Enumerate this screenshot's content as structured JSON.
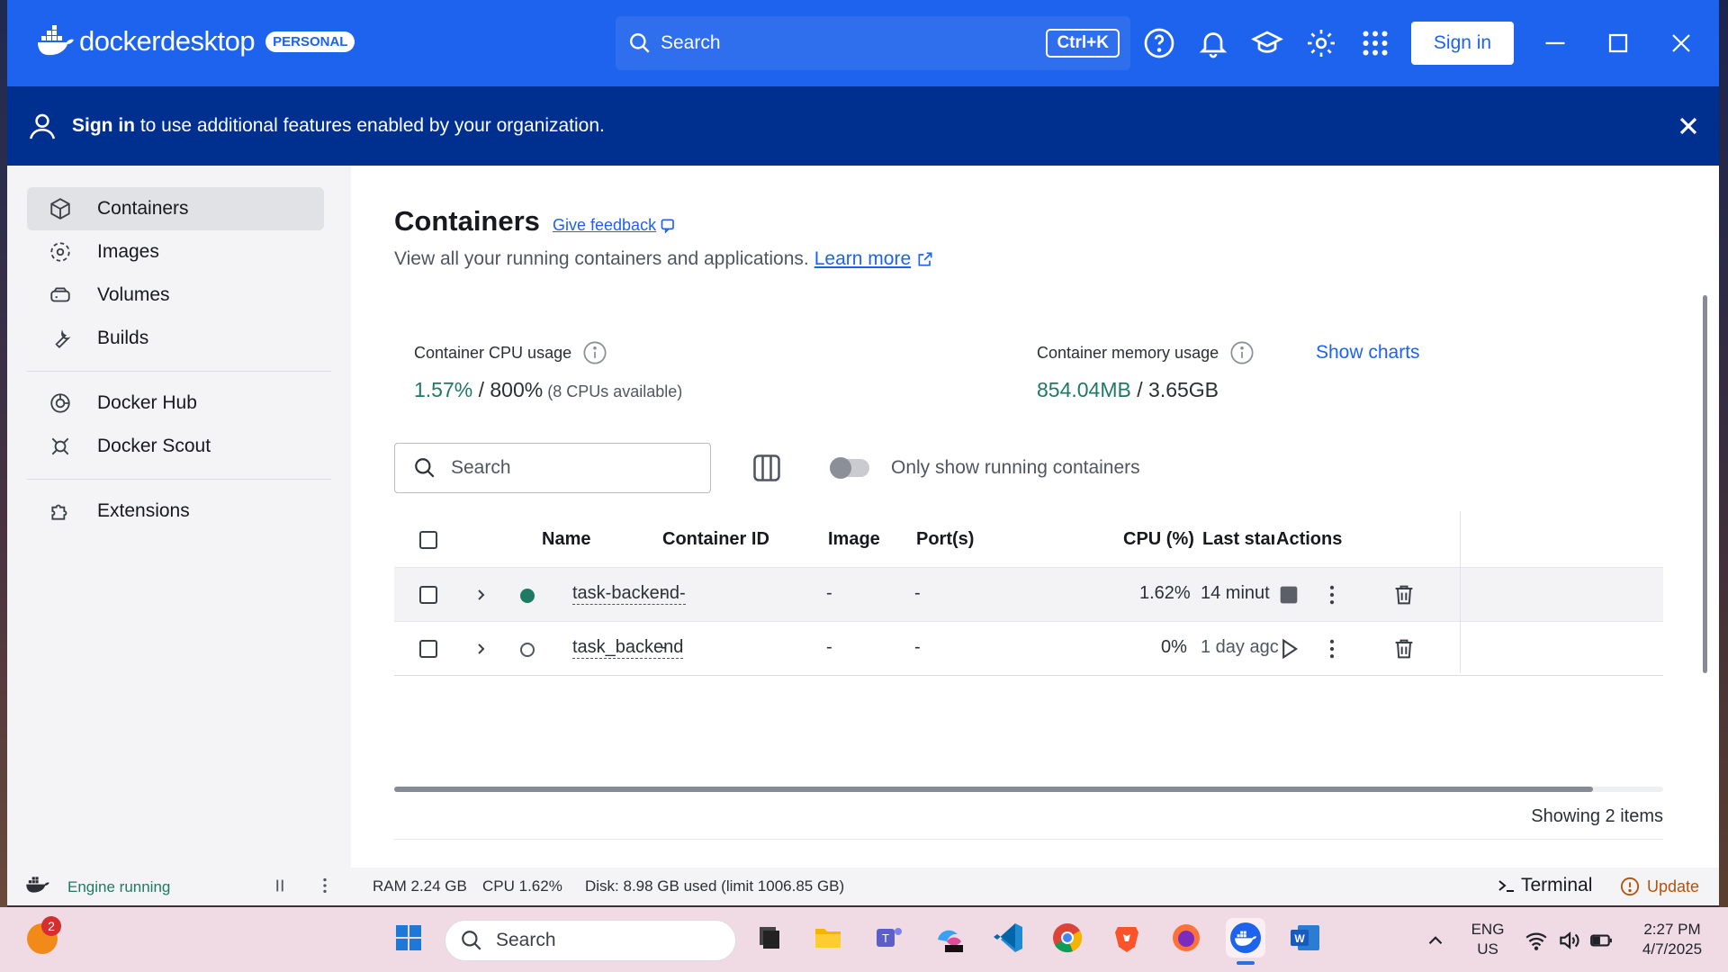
{
  "app": {
    "logo_bold": "docker",
    "logo_light": "desktop",
    "plan_badge": "PERSONAL",
    "search_label": "Search",
    "search_shortcut": "Ctrl+K",
    "sign_in_label": "Sign in",
    "brand_color": "#1d63ed"
  },
  "banner": {
    "bold": "Sign in",
    "text": " to use additional features enabled by your organization."
  },
  "sidebar": {
    "items": [
      {
        "label": "Containers",
        "icon": "cube-icon",
        "active": true
      },
      {
        "label": "Images",
        "icon": "images-icon"
      },
      {
        "label": "Volumes",
        "icon": "volumes-icon"
      },
      {
        "label": "Builds",
        "icon": "wrench-icon"
      },
      {
        "label": "Docker Hub",
        "icon": "hub-icon"
      },
      {
        "label": "Docker Scout",
        "icon": "scout-icon"
      },
      {
        "label": "Extensions",
        "icon": "puzzle-icon"
      }
    ]
  },
  "main": {
    "title": "Containers",
    "feedback_link": "Give feedback",
    "subtitle": "View all your running containers and applications.",
    "learn_more": "Learn more",
    "cpu": {
      "label": "Container CPU usage",
      "used": "1.57%",
      "sep": " / ",
      "total": "800%",
      "note": " (8 CPUs available)"
    },
    "memory": {
      "label": "Container memory usage",
      "used": "854.04MB",
      "sep": " / ",
      "total": "3.65GB"
    },
    "show_charts": "Show charts",
    "search_placeholder": "Search",
    "toggle_label": "Only show running containers",
    "table": {
      "headers": {
        "name": "Name",
        "container_id": "Container ID",
        "image": "Image",
        "ports": "Port(s)",
        "cpu": "CPU (%)",
        "last_started": "Last star",
        "actions": "Actions"
      },
      "rows": [
        {
          "name": "task-backend-",
          "container_id": "-",
          "image": "-",
          "ports": "-",
          "cpu": "1.62%",
          "last_started": "14 minut",
          "running": true
        },
        {
          "name": "task_backend",
          "container_id": "-",
          "image": "-",
          "ports": "-",
          "cpu": "0%",
          "last_started": "1 day agc",
          "running": false
        }
      ]
    },
    "showing": "Showing 2 items"
  },
  "statusbar": {
    "engine": "Engine running",
    "ram": "RAM 2.24 GB",
    "cpu": "CPU 1.62%",
    "disk": "Disk: 8.98 GB used (limit 1006.85 GB)",
    "terminal": "Terminal",
    "update": "Update",
    "engine_color": "#1f7a63",
    "update_color": "#b45309"
  },
  "taskbar": {
    "search_label": "Search",
    "notification_count": "2",
    "lang_line1": "ENG",
    "lang_line2": "US",
    "time": "2:27 PM",
    "date": "4/7/2025"
  }
}
